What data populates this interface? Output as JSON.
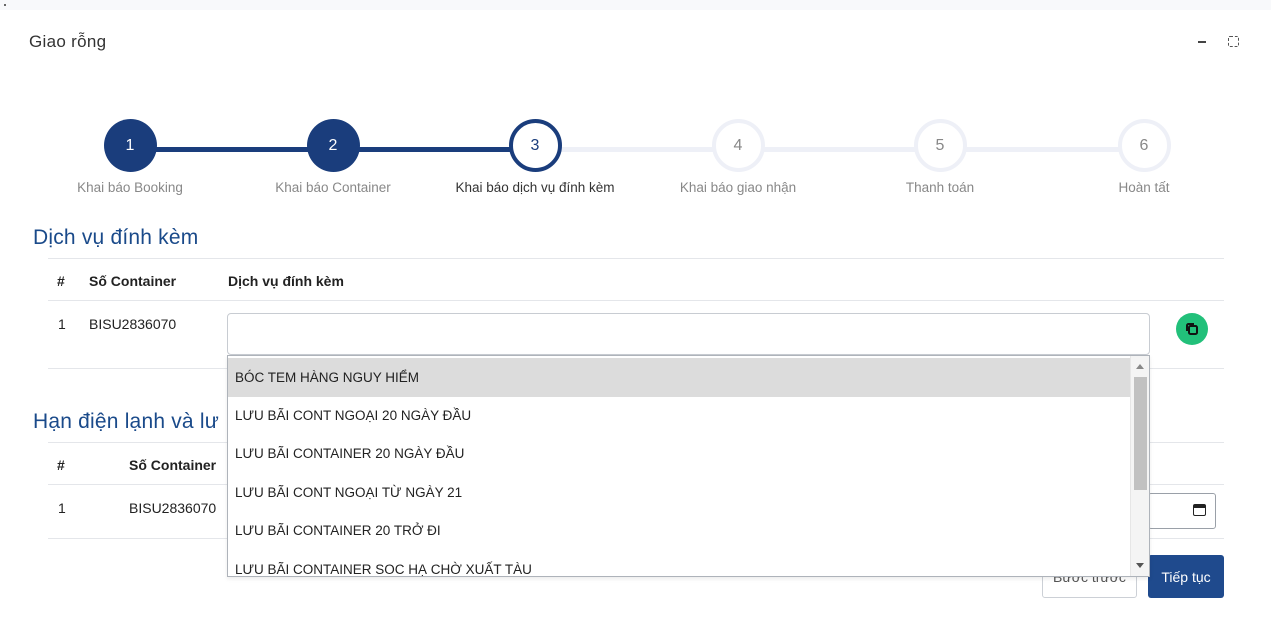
{
  "modal": {
    "title": "Giao rỗng",
    "minimize_label": "",
    "expand_label": ""
  },
  "stepper": {
    "steps": [
      {
        "number": "1",
        "label": "Khai báo Booking",
        "state": "done"
      },
      {
        "number": "2",
        "label": "Khai báo Container",
        "state": "done"
      },
      {
        "number": "3",
        "label": "Khai báo dịch vụ đính kèm",
        "state": "active"
      },
      {
        "number": "4",
        "label": "Khai báo giao nhận",
        "state": "todo"
      },
      {
        "number": "5",
        "label": "Thanh toán",
        "state": "todo"
      },
      {
        "number": "6",
        "label": "Hoàn tất",
        "state": "todo"
      }
    ]
  },
  "services": {
    "title": "Dịch vụ đính kèm",
    "headers": [
      "#",
      "Số Container",
      "Dịch vụ đính kèm"
    ],
    "rows": [
      {
        "index": "1",
        "container": "BISU2836070",
        "service": ""
      }
    ]
  },
  "dropdown": {
    "options": [
      "BÓC TEM HÀNG NGUY HIỂM",
      "LƯU BÃI CONT NGOẠI 20 NGÀY ĐẦU",
      "LƯU BÃI CONTAINER 20 NGÀY ĐẦU",
      "LƯU BÃI CONT NGOẠI TỪ NGÀY 21",
      "LƯU BÃI CONTAINER 20 TRỞ ĐI",
      "LƯU BÃI CONTAINER SOC HẠ CHỜ XUẤT TÀU"
    ],
    "highlighted_index": 0
  },
  "reefer": {
    "title": "Hạn điện lạnh và lư",
    "headers": [
      "#",
      "Số Container"
    ],
    "rows": [
      {
        "index": "1",
        "container": "BISU2836070"
      }
    ]
  },
  "actions": {
    "prev_label": "Bước trước",
    "next_label": "Tiếp tục"
  },
  "colors": {
    "primary": "#1a3d7c",
    "accent_green": "#22c07a",
    "section_title": "#1a4a8a"
  },
  "icons": {
    "minimize": "minimize-icon",
    "expand": "expand-icon",
    "copy": "copy-icon",
    "calendar": "calendar-icon"
  }
}
